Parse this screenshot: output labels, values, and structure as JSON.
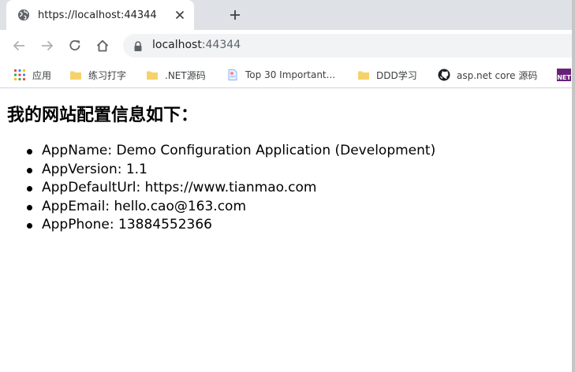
{
  "browser": {
    "tab": {
      "title": "https://localhost:44344"
    },
    "address_bar": {
      "host": "localhost",
      "port": ":44344"
    },
    "bookmarks": [
      {
        "label": "应用",
        "icon": "apps-grid-icon"
      },
      {
        "label": "练习打字",
        "icon": "folder-icon"
      },
      {
        "label": ".NET源码",
        "icon": "folder-icon"
      },
      {
        "label": "Top 30 Important...",
        "icon": "page-icon"
      },
      {
        "label": "DDD学习",
        "icon": "folder-icon"
      },
      {
        "label": "asp.net core 源码",
        "icon": "github-icon"
      }
    ],
    "overflow_bookmark_badge": "NET"
  },
  "page": {
    "heading": "我的网站配置信息如下：",
    "config_items": [
      "AppName: Demo Configuration Application (Development)",
      "AppVersion: 1.1",
      "AppDefaultUrl: https://www.tianmao.com",
      "AppEmail: hello.cao@163.com",
      "AppPhone: 13884552366"
    ]
  },
  "colors": {
    "tabstrip_bg": "#dee1e6",
    "omnibox_bg": "#f1f3f4",
    "folder_yellow": "#f5d26b",
    "net_badge": "#68217a"
  }
}
